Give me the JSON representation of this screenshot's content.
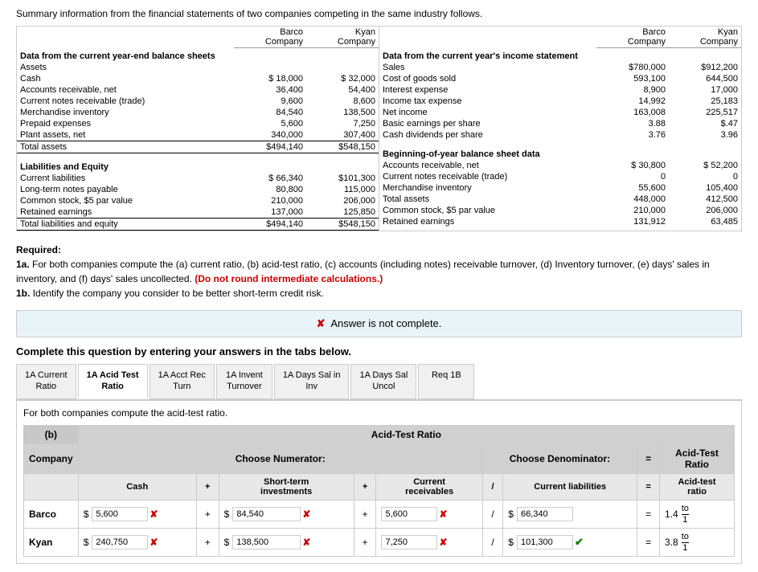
{
  "summary": {
    "intro": "Summary information from the financial statements of two companies competing in the same industry follows."
  },
  "left_table": {
    "headers": [
      "",
      "Barco Company",
      "Kyan Company"
    ],
    "section1_title": "Data from the current year-end balance sheets",
    "section1_subtitle": "Assets",
    "rows1": [
      {
        "label": "Cash",
        "barco": "$ 18,000",
        "kyan": "$ 32,000"
      },
      {
        "label": "Accounts receivable, net",
        "barco": "36,400",
        "kyan": "54,400"
      },
      {
        "label": "Current notes receivable (trade)",
        "barco": "9,600",
        "kyan": "8,600"
      },
      {
        "label": "Merchandise inventory",
        "barco": "84,540",
        "kyan": "138,500"
      },
      {
        "label": "Prepaid expenses",
        "barco": "5,600",
        "kyan": "7,250"
      },
      {
        "label": "Plant assets, net",
        "barco": "340,000",
        "kyan": "307,400"
      }
    ],
    "total_assets": {
      "label": "Total assets",
      "barco": "$494,140",
      "kyan": "$548,150"
    },
    "section2_title": "Liabilities and Equity",
    "rows2": [
      {
        "label": "Current liabilities",
        "barco": "$ 66,340",
        "kyan": "$101,300"
      },
      {
        "label": "Long-term notes payable",
        "barco": "80,800",
        "kyan": "115,000"
      },
      {
        "label": "Common stock, $5 par value",
        "barco": "210,000",
        "kyan": "206,000"
      },
      {
        "label": "Retained earnings",
        "barco": "137,000",
        "kyan": "125,850"
      }
    ],
    "total_liabilities": {
      "label": "Total liabilities and equity",
      "barco": "$494,140",
      "kyan": "$548,150"
    }
  },
  "right_table": {
    "headers": [
      "",
      "Barco Company",
      "Kyan Company"
    ],
    "section1_title": "Data from the current year's income statement",
    "rows1": [
      {
        "label": "Sales",
        "barco": "$780,000",
        "kyan": "$912,200"
      },
      {
        "label": "Cost of goods sold",
        "barco": "593,100",
        "kyan": "644,500"
      },
      {
        "label": "Interest expense",
        "barco": "8,900",
        "kyan": "17,000"
      },
      {
        "label": "Income tax expense",
        "barco": "14,992",
        "kyan": "25,183"
      },
      {
        "label": "Net income",
        "barco": "163,008",
        "kyan": "225,517"
      },
      {
        "label": "Basic earnings per share",
        "barco": "3.88",
        "kyan": "$.47"
      },
      {
        "label": "Cash dividends per share",
        "barco": "3.76",
        "kyan": "3.96"
      }
    ],
    "section2_title": "Beginning-of-year balance sheet data",
    "rows2": [
      {
        "label": "Accounts receivable, net",
        "barco": "$ 30,800",
        "kyan": "$ 52,200"
      },
      {
        "label": "Current notes receivable (trade)",
        "barco": "0",
        "kyan": "0"
      },
      {
        "label": "Merchandise inventory",
        "barco": "55,600",
        "kyan": "105,400"
      },
      {
        "label": "Total assets",
        "barco": "448,000",
        "kyan": "412,500"
      },
      {
        "label": "Common stock, $5 par value",
        "barco": "210,000",
        "kyan": "206,000"
      },
      {
        "label": "Retained earnings",
        "barco": "131,912",
        "kyan": "63,485"
      }
    ]
  },
  "required": {
    "label": "Required:",
    "part1a_label": "1a.",
    "part1a_text": "For both companies compute the (a) current ratio, (b) acid-test ratio, (c) accounts (including notes) receivable turnover, (d) Inventory turnover, (e) days' sales in inventory, and (f) days' sales uncollected.",
    "part1a_bold": "(Do not round intermediate calculations.)",
    "part1b_label": "1b.",
    "part1b_text": "Identify the company you consider to be better short-term credit risk."
  },
  "answer_banner": {
    "text": "Answer is not complete."
  },
  "complete_question": {
    "text": "Complete this question by entering your answers in the tabs below."
  },
  "tabs": [
    {
      "label": "1A Current\nRatio",
      "id": "current-ratio"
    },
    {
      "label": "1A Acid Test\nRatio",
      "id": "acid-test",
      "active": true
    },
    {
      "label": "1A Acct Rec\nTurn",
      "id": "acct-rec"
    },
    {
      "label": "1A Invent\nTurnover",
      "id": "invent-turnover"
    },
    {
      "label": "1A Days Sal in\nInv",
      "id": "days-sal-inv"
    },
    {
      "label": "1A Days Sal\nUncol",
      "id": "days-sal-uncol"
    },
    {
      "label": "Req 1B",
      "id": "req-1b"
    }
  ],
  "tab_content": {
    "description": "For both companies compute the acid-test ratio.",
    "table": {
      "section_label": "(b)",
      "title": "Acid-Test Ratio",
      "headers": {
        "company": "Company",
        "numerator": "Choose Numerator:",
        "denominator": "Choose Denominator:",
        "equals": "=",
        "result": "Acid-Test\nRatio"
      },
      "sub_headers": {
        "cash": "Cash",
        "plus1": "+",
        "short_term": "Short-term\ninvestments",
        "plus2": "+",
        "current_rec": "Current\nreceivables",
        "slash": "/",
        "current_liab": "Current liabilities",
        "equals": "=",
        "acid_test": "Acid-test\nratio"
      },
      "rows": [
        {
          "company": "Barco",
          "cash_dollar": "$",
          "cash_value": "5,600",
          "cash_check": "x",
          "plus1": "+",
          "short_term_dollar": "$",
          "short_term_value": "84,540",
          "short_term_check": "x",
          "plus2": "+",
          "current_rec_value": "5,600",
          "current_rec_check": "x",
          "slash": "/",
          "denom_dollar": "$",
          "denom_value": "66,340",
          "equals": "=",
          "result": "1.4",
          "result_fraction": "to\n1"
        },
        {
          "company": "Kyan",
          "cash_dollar": "$",
          "cash_value": "240,750",
          "cash_check": "x",
          "plus1": "+",
          "short_term_dollar": "$",
          "short_term_value": "138,500",
          "short_term_check": "x",
          "plus2": "+",
          "current_rec_value": "7,250",
          "current_rec_check": "x",
          "slash": "/",
          "denom_dollar": "$",
          "denom_value": "101,300",
          "denom_check": "check",
          "equals": "=",
          "result": "3.8",
          "result_fraction": "to\n1"
        }
      ]
    }
  }
}
